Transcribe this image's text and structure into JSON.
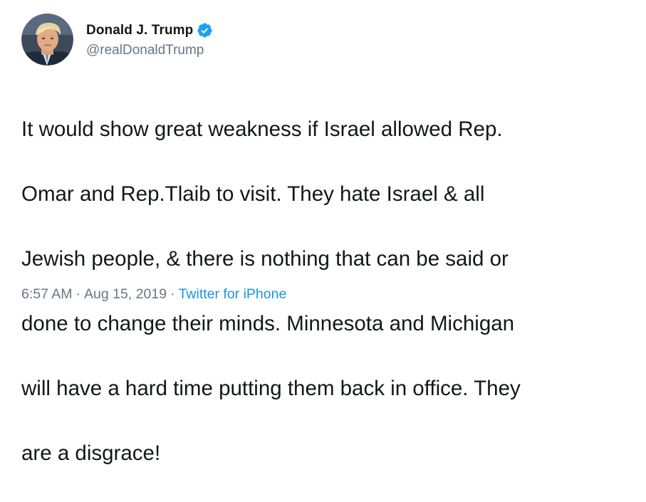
{
  "author": {
    "display_name": "Donald J. Trump",
    "handle": "@realDonaldTrump",
    "verified": true
  },
  "tweet": {
    "lines": [
      "It would show great weakness if Israel allowed Rep.",
      "Omar and Rep.Tlaib to visit. They hate Israel & all",
      "Jewish people, & there is nothing that can be said or",
      "done to change their minds. Minnesota and Michigan",
      "will have a hard time putting them back in office. They",
      "are a disgrace!"
    ],
    "time": "6:57 AM",
    "date": "Aug 15, 2019",
    "separator": "·",
    "source": "Twitter for iPhone"
  },
  "colors": {
    "text": "#14171a",
    "secondary": "#657786",
    "link": "#1b95e0",
    "verified": "#1da1f2"
  },
  "icons": {
    "verified": "verified-badge-icon",
    "avatar": "avatar-photo"
  }
}
